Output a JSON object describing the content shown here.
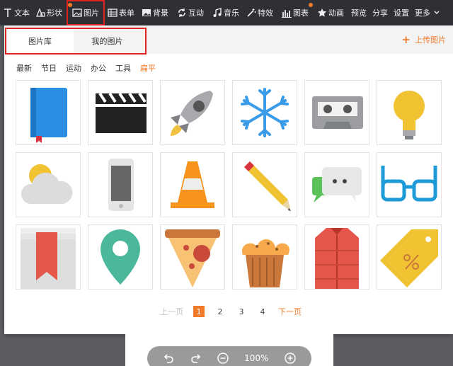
{
  "toolbar": {
    "items": [
      {
        "label": "文本",
        "icon": "text-icon"
      },
      {
        "label": "形状",
        "icon": "shape-icon"
      },
      {
        "label": "图片",
        "icon": "image-icon"
      },
      {
        "label": "表单",
        "icon": "table-icon"
      },
      {
        "label": "背景",
        "icon": "background-icon"
      },
      {
        "label": "互动",
        "icon": "interact-icon"
      },
      {
        "label": "音乐",
        "icon": "music-icon"
      },
      {
        "label": "特效",
        "icon": "effects-icon"
      },
      {
        "label": "图表",
        "icon": "chart-icon"
      },
      {
        "label": "动画",
        "icon": "star-icon"
      },
      {
        "label": "预览"
      },
      {
        "label": "分享"
      },
      {
        "label": "设置"
      },
      {
        "label": "更多",
        "icon": "chevron-down-icon"
      }
    ]
  },
  "panel": {
    "tabs": [
      {
        "label": "图片库"
      },
      {
        "label": "我的图片"
      }
    ],
    "upload_label": "上传图片",
    "categories": [
      "最新",
      "节日",
      "运动",
      "办公",
      "工具",
      "扁平"
    ],
    "active_category": "扁平",
    "images": [
      "blue-book-icon",
      "clapperboard-icon",
      "rocket-icon",
      "snowflake-icon",
      "cassette-icon",
      "lightbulb-icon",
      "weather-cloud-icon",
      "smartphone-icon",
      "traffic-cone-icon",
      "pencil-icon",
      "chat-bubbles-icon",
      "glasses-icon",
      "bookmark-icon",
      "map-pin-icon",
      "pizza-slice-icon",
      "cupcake-icon",
      "vest-icon",
      "price-tag-icon"
    ],
    "pagination": {
      "prev_label": "上一页",
      "pages": [
        "1",
        "2",
        "3",
        "4"
      ],
      "current": "1",
      "next_label": "下一页"
    }
  },
  "zoom": {
    "level": "100%"
  },
  "colors": {
    "accent": "#f07a2a",
    "highlight": "#e02424",
    "toolbar_bg": "#2f3035"
  }
}
